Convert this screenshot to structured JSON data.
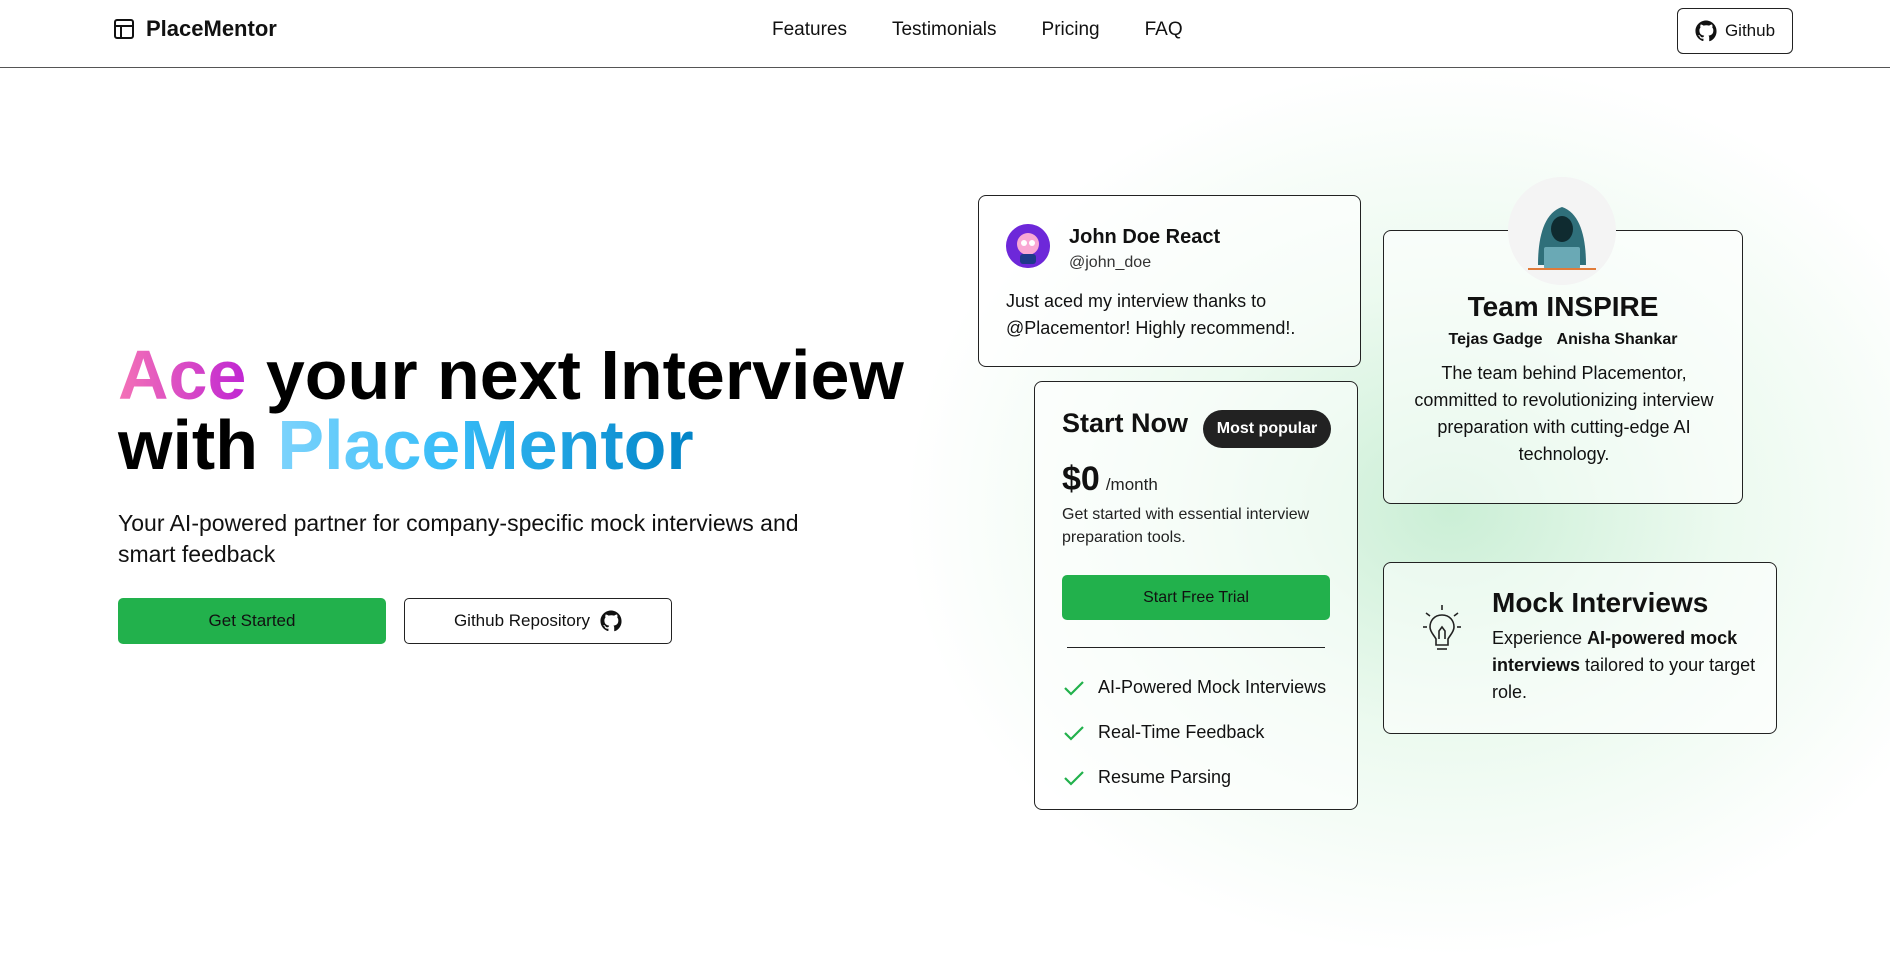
{
  "nav": {
    "brand": "PlaceMentor",
    "links": [
      "Features",
      "Testimonials",
      "Pricing",
      "FAQ"
    ],
    "github_label": "Github"
  },
  "hero": {
    "title_ace": "Ace",
    "title_rest": " your next Interview with ",
    "title_brand": "PlaceMentor",
    "subtitle": "Your AI-powered partner for company-specific mock interviews and smart feedback",
    "primary_button": "Get Started",
    "secondary_button": "Github Repository"
  },
  "testimonial": {
    "name": "John Doe React",
    "handle": "@john_doe",
    "text": "Just aced my interview thanks to @Placementor! Highly recommend!."
  },
  "team": {
    "title": "Team INSPIRE",
    "members": [
      "Tejas Gadge",
      "Anisha Shankar"
    ],
    "description": "The team behind Placementor, committed to revolutionizing interview preparation with cutting-edge AI technology."
  },
  "pricing": {
    "title": "Start Now",
    "badge": "Most popular",
    "price": "$0",
    "period": "/month",
    "description": "Get started with essential interview preparation tools.",
    "cta": "Start Free Trial",
    "features": [
      "AI-Powered Mock Interviews",
      "Real-Time Feedback",
      "Resume Parsing"
    ]
  },
  "mock_card": {
    "title": "Mock Interviews",
    "desc_prefix": "Experience ",
    "desc_bold": "AI-powered mock interviews",
    "desc_suffix": " tailored to your target role."
  },
  "colors": {
    "accent_green": "#22b14c",
    "gradient_pink_start": "#f472b6",
    "gradient_pink_end": "#c026d3",
    "gradient_blue_start": "#7dd3fc",
    "gradient_blue_end": "#0284c7"
  },
  "icons": {
    "brand": "layout-panel-icon",
    "github": "github-icon",
    "check": "check-icon",
    "bulb": "lightbulb-icon"
  }
}
